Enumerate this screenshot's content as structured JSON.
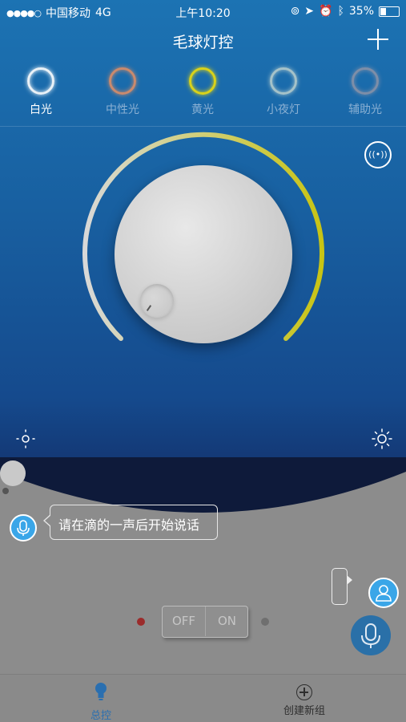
{
  "status_bar": {
    "carrier": "中国移动",
    "network": "4G",
    "time": "上午10:20",
    "battery_percent": "35%",
    "battery_level": 0.35
  },
  "header": {
    "title": "毛球灯控"
  },
  "modes": [
    {
      "label": "白光",
      "ring_color": "#e9f1f7",
      "active": true
    },
    {
      "label": "中性光",
      "ring_color": "#c98a6e",
      "active": false
    },
    {
      "label": "黄光",
      "ring_color": "#d9d21a",
      "active": false
    },
    {
      "label": "小夜灯",
      "ring_color": "#a5c2c9",
      "active": false
    },
    {
      "label": "辅助光",
      "ring_color": "#7d8ea8",
      "active": false
    }
  ],
  "dial": {
    "arc_start_color": "#d8d8d8",
    "arc_end_color": "#c8c414"
  },
  "voice": {
    "prompt": "请在滴的一声后开始说话"
  },
  "power_switch": {
    "off_label": "OFF",
    "on_label": "ON"
  },
  "nav": {
    "home_label": "总控",
    "create_label": "创建新组"
  },
  "colors": {
    "accent": "#3aa6e8",
    "nav_active": "#2a6fb0"
  }
}
